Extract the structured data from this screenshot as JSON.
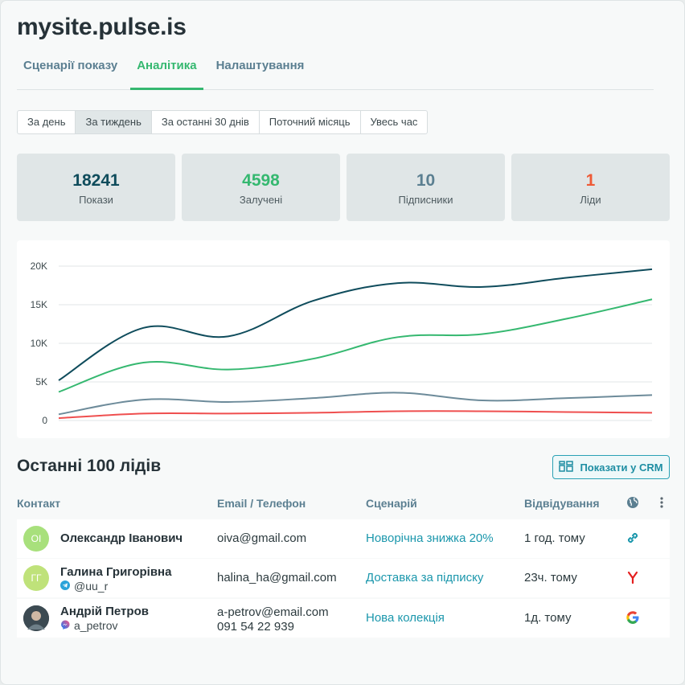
{
  "site": {
    "title": "mysite.pulse.is"
  },
  "tabs": [
    {
      "label": "Сценарії показу"
    },
    {
      "label": "Аналітика"
    },
    {
      "label": "Налаштування"
    }
  ],
  "periods": [
    {
      "label": "За день"
    },
    {
      "label": "За тиждень"
    },
    {
      "label": "За останні 30 днів"
    },
    {
      "label": "Поточний місяць"
    },
    {
      "label": "Увесь час"
    }
  ],
  "stats": [
    {
      "value": "18241",
      "label": "Покази",
      "color": "#0f4c5c"
    },
    {
      "value": "4598",
      "label": "Залучені",
      "color": "#35b870"
    },
    {
      "value": "10",
      "label": "Підписники",
      "color": "#5b7f91"
    },
    {
      "value": "1",
      "label": "Ліди",
      "color": "#ee5a36"
    }
  ],
  "chart_data": {
    "type": "line",
    "y_ticks": [
      "20K",
      "15K",
      "10K",
      "5K",
      "0"
    ],
    "ylim": [
      0,
      20000
    ],
    "x": [
      0,
      1,
      2,
      3,
      4,
      5,
      6,
      7
    ],
    "series": [
      {
        "color": "#0f4c5c",
        "values": [
          5200,
          12000,
          10900,
          15500,
          17800,
          17300,
          18500,
          19600
        ]
      },
      {
        "color": "#35b870",
        "values": [
          3700,
          7500,
          6600,
          8000,
          10800,
          11200,
          13200,
          15700
        ]
      },
      {
        "color": "#6d8b9a",
        "values": [
          800,
          2700,
          2400,
          2900,
          3600,
          2600,
          2900,
          3300
        ]
      },
      {
        "color": "#ef4f4f",
        "values": [
          300,
          900,
          900,
          1000,
          1200,
          1200,
          1100,
          1000
        ]
      }
    ],
    "grid": true
  },
  "leads": {
    "title": "Останні 100 лідів",
    "crm_button": "Показати у CRM",
    "columns": {
      "contact": "Контакт",
      "email": "Email / Телефон",
      "scenario": "Сценарій",
      "visit": "Відвідування"
    },
    "rows": [
      {
        "initials": "ОІ",
        "avatar_color": "#a8e07c",
        "name": "Олександр Іванович",
        "handle": "",
        "handle_icon": "",
        "email": "oiva@gmail.com",
        "phone": "",
        "scenario": "Новорічна знижка 20%",
        "visit": "1 год. тому",
        "source_icon": "link-icon"
      },
      {
        "initials": "ГГ",
        "avatar_color": "#bfe27a",
        "name": "Галина Григорівна",
        "handle": "@uu_r",
        "handle_icon": "telegram-icon",
        "email": "halina_ha@gmail.com",
        "phone": "",
        "scenario": "Доставка за підписку",
        "visit": "23ч. тому",
        "source_icon": "yandex-icon"
      },
      {
        "initials": "",
        "avatar_color": "#3c4a52",
        "name": "Андрій Петров",
        "handle": "a_petrov",
        "handle_icon": "messenger-icon",
        "email": "a-petrov@email.com",
        "phone": "091 54 22 939",
        "scenario": "Нова колекція",
        "visit": "1д. тому",
        "source_icon": "google-icon"
      }
    ]
  }
}
